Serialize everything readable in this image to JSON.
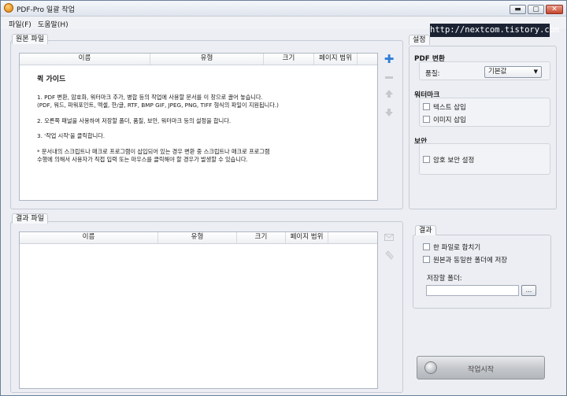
{
  "window": {
    "title": "PDF-Pro 일괄 작업",
    "buttons": {
      "minimize": "▬",
      "maximize": "▢",
      "close": "✕"
    }
  },
  "menu": [
    "파일(F)",
    "도움말(H)"
  ],
  "watermark": "http://nextcom.tistory.com",
  "source": {
    "tab": "원본 파일",
    "columns": [
      "이름",
      "유형",
      "크기",
      "페이지 범위"
    ],
    "guide": {
      "title": "퀵 가이드",
      "step1_line1": "1. PDF 변환, 암호화, 워터마크 추가, 병합 등의 작업에 사용할 문서를 이 창으로 끌어 놓습니다.",
      "step1_line2": "(PDF, 워드, 파워포인트, 엑셀, 한/글, RTF, BMP GIF, JPEG, PNG, TIFF 형식의 파일이 지원됩니다.)",
      "step2": "2. 오른쪽 패널을 사용하여 저장할 폴더, 품질, 보안, 워터마크 등의 설정을 합니다.",
      "step3": "3. '작업 시작'을 클릭합니다.",
      "note_line1": "* 문서내의 스크립트나 매크로 프로그램이 삽입되어 있는 경우 변환 중 스크립트나 매크로 프로그램",
      "note_line2": "수행에 의해서 사용자가 직접 입력 또는 마우스를 클릭해야 할 경우가 발생할 수 있습니다."
    },
    "side_icons": [
      "add-icon",
      "remove-icon",
      "move-up-icon",
      "move-down-icon"
    ]
  },
  "result": {
    "tab": "결과 파일",
    "columns": [
      "이름",
      "유형",
      "크기",
      "페이지 범위"
    ],
    "side_icons": [
      "mail-icon",
      "attach-icon"
    ]
  },
  "settings": {
    "tab": "설정",
    "pdf_title": "PDF 변환",
    "quality_label": "품질:",
    "quality_value": "기본값",
    "watermark_title": "워터마크",
    "text_watermark": "텍스트 삽입",
    "image_watermark": "이미지 삽입",
    "security_title": "보안",
    "password_security": "암호 보안 설정"
  },
  "output": {
    "tab": "결과",
    "merge_label": "한 파일로 합치기",
    "same_folder_label": "원본과 동일한 폴더에 저장",
    "folder_label": "저장할 폴더:",
    "folder_value": "",
    "browse_label": "..."
  },
  "start_button": "작업시작",
  "colors": {
    "add_icon": "#2f7fd6",
    "accent": "#6b7f99"
  }
}
